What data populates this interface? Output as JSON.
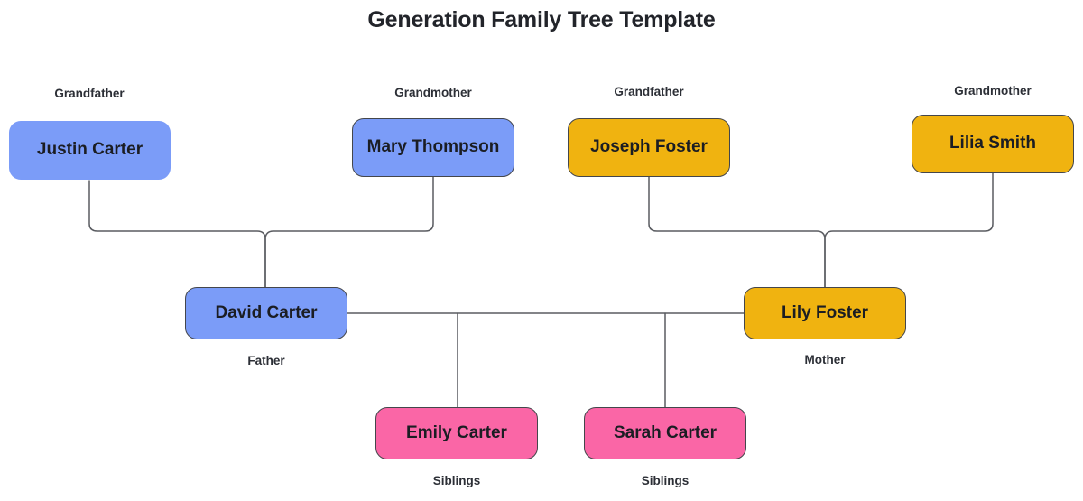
{
  "page": {
    "title": "Generation Family Tree Template",
    "background": "#ffffff"
  },
  "colors": {
    "paternal": "#7b9cf8",
    "maternal": "#f0b310",
    "children": "#fa66a6",
    "stroke": "#44464b",
    "connector": "#5a5c61",
    "text": "#1b1d23",
    "label_text": "#2c2f36"
  },
  "nodes": {
    "grandfather_paternal": {
      "name": "Justin Carter",
      "role": "Grandfather"
    },
    "grandmother_paternal": {
      "name": "Mary Thompson",
      "role": "Grandmother"
    },
    "grandfather_maternal": {
      "name": "Joseph Foster",
      "role": "Grandfather"
    },
    "grandmother_maternal": {
      "name": "Lilia Smith",
      "role": "Grandmother"
    },
    "father": {
      "name": "David Carter",
      "role": "Father"
    },
    "mother": {
      "name": "Lily Foster",
      "role": "Mother"
    },
    "sibling_one": {
      "name": "Emily Carter",
      "role": "Siblings"
    },
    "sibling_two": {
      "name": "Sarah Carter",
      "role": "Siblings"
    }
  }
}
